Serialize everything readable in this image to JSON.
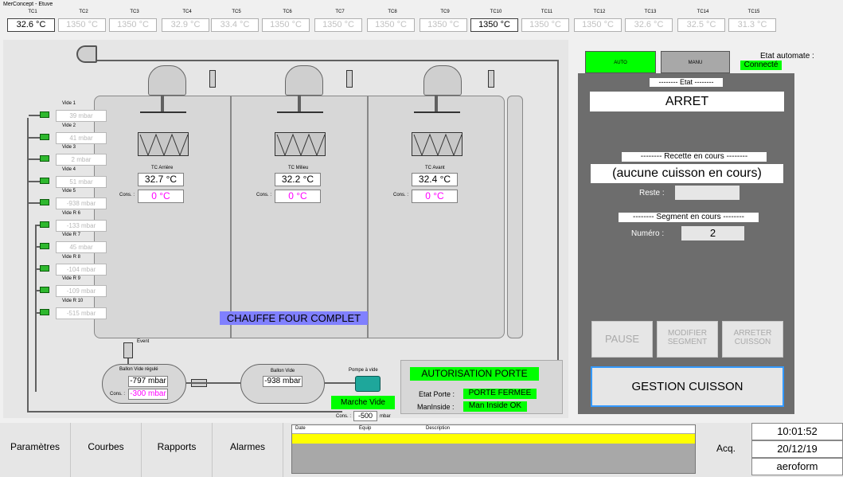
{
  "window": {
    "title": "MerConcept - Etuve"
  },
  "tc": [
    {
      "label": "TC1",
      "value": "32.6 °C",
      "active": true
    },
    {
      "label": "TC2",
      "value": "1350 °C",
      "active": false
    },
    {
      "label": "TC3",
      "value": "1350 °C",
      "active": false
    },
    {
      "label": "TC4",
      "value": "32.9 °C",
      "active": false
    },
    {
      "label": "TC5",
      "value": "33.4 °C",
      "active": false
    },
    {
      "label": "TC6",
      "value": "1350 °C",
      "active": false
    },
    {
      "label": "TC7",
      "value": "1350 °C",
      "active": false
    },
    {
      "label": "TC8",
      "value": "1350 °C",
      "active": false
    },
    {
      "label": "TC9",
      "value": "1350 °C",
      "active": false
    },
    {
      "label": "TC10",
      "value": "1350 °C",
      "active": true
    },
    {
      "label": "TC11",
      "value": "1350 °C",
      "active": false
    },
    {
      "label": "TC12",
      "value": "1350 °C",
      "active": false
    },
    {
      "label": "TC13",
      "value": "32.6 °C",
      "active": false
    },
    {
      "label": "TC14",
      "value": "32.5 °C",
      "active": false
    },
    {
      "label": "TC15",
      "value": "31.3 °C",
      "active": false
    }
  ],
  "vacuums": [
    {
      "label": "Vide 1",
      "value": "39 mbar"
    },
    {
      "label": "Vide 2",
      "value": "41 mbar"
    },
    {
      "label": "Vide 3",
      "value": "2 mbar"
    },
    {
      "label": "Vide 4",
      "value": "51 mbar"
    },
    {
      "label": "Vide 5",
      "value": "-938 mbar"
    },
    {
      "label": "Vide R 6",
      "value": "-133 mbar"
    },
    {
      "label": "Vide R 7",
      "value": "45 mbar"
    },
    {
      "label": "Vide R 8",
      "value": "-104 mbar"
    },
    {
      "label": "Vide R 9",
      "value": "-109 mbar"
    },
    {
      "label": "Vide R 10",
      "value": "-515 mbar"
    }
  ],
  "zones": [
    {
      "label": "TC Arrière",
      "temp": "32.7 °C",
      "cons_label": "Cons. :",
      "cons": "0 °C"
    },
    {
      "label": "TC Milieu",
      "temp": "32.2 °C",
      "cons_label": "Cons. :",
      "cons": "0 °C"
    },
    {
      "label": "TC Avant",
      "temp": "32.4 °C",
      "cons_label": "Cons. :",
      "cons": "0 °C"
    }
  ],
  "chauffe_label": "CHAUFFE FOUR COMPLET",
  "event_label": "Event",
  "ballon_regule": {
    "title": "Ballon Vide régulé",
    "value": "-797 mbar",
    "cons_label": "Cons. :",
    "cons": "-300 mbar"
  },
  "ballon_vide": {
    "title": "Ballon Vide",
    "value": "-938 mbar"
  },
  "pompe": {
    "title": "Pompe à vide",
    "button": "Marche Vide",
    "cons_label": "Cons. :",
    "cons": "-500",
    "unit": "mbar"
  },
  "door": {
    "title": "AUTORISATION PORTE",
    "etat_label": "Etat Porte :",
    "etat_value": "PORTE FERMEE",
    "maninside_label": "ManInside :",
    "maninside_value": "Man Inside OK"
  },
  "mode": {
    "auto": "AUTO",
    "manu": "MANU",
    "etat_automate_label": "Etat automate :",
    "etat_automate_value": "Connecté"
  },
  "right_panel": {
    "etat_header": "-------- Etat --------",
    "etat_value": "ARRET",
    "recette_header": "-------- Recette en cours --------",
    "recette_value": "(aucune cuisson en cours)",
    "reste_label": "Reste :",
    "reste_value": "",
    "segment_header": "-------- Segment en cours --------",
    "numero_label": "Numéro :",
    "numero_value": "2",
    "pause": "PAUSE",
    "modifier_line1": "MODIFIER",
    "modifier_line2": "SEGMENT",
    "arreter_line1": "ARRETER",
    "arreter_line2": "CUISSON",
    "gestion": "GESTION CUISSON"
  },
  "bottom": {
    "buttons": [
      "Paramètres",
      "Courbes",
      "Rapports",
      "Alarmes"
    ],
    "alarm_cols": [
      "Date",
      "Equip",
      "Description"
    ],
    "acq": "Acq.",
    "time": "10:01:52",
    "date": "20/12/19",
    "company": "aeroform"
  },
  "colors": {
    "accent_green": "#00ff00",
    "pink": "#ff00ff",
    "panel": "#6d6d6d",
    "chauffe_bg": "#8080ff"
  }
}
